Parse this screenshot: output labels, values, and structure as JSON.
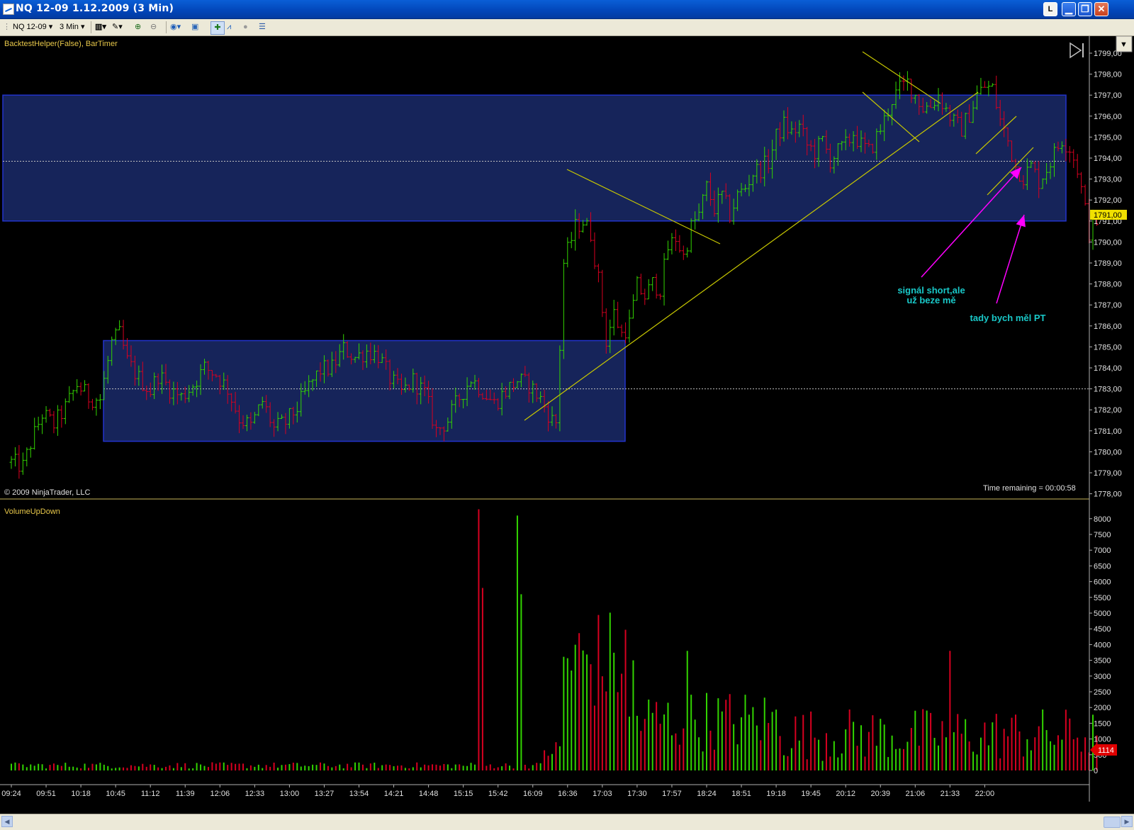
{
  "window": {
    "title": "NQ 12-09  1.12.2009 (3 Min)",
    "layout_button": "L"
  },
  "toolbar": {
    "instrument": "NQ 12-09",
    "interval": "3 Min"
  },
  "price_panel": {
    "indicator_label": "BacktestHelper(False), BarTimer",
    "copyright": "© 2009 NinjaTrader, LLC",
    "time_remaining": "Time remaining = 00:00:58",
    "current_price": "1791,00",
    "annotations": {
      "signal_line1": "signál short,ale",
      "signal_line2": "už beze mě",
      "pt_note": "tady bych měl PT"
    },
    "colors": {
      "up": "#32d400",
      "down": "#d80020",
      "zone": "#1a2a6a",
      "trendline": "#c8c800",
      "arrow": "#ff00ff",
      "annotation": "#19c8c8"
    }
  },
  "volume_panel": {
    "indicator_label": "VolumeUpDown",
    "current_volume": "1114"
  },
  "chart_data": [
    {
      "type": "candlestick",
      "title": "NQ 12-09  1.12.2009 (3 Min)",
      "ylim": [
        1777.5,
        1799.5
      ],
      "y_ticks": [
        "1778,00",
        "1779,00",
        "1780,00",
        "1781,00",
        "1782,00",
        "1783,00",
        "1784,00",
        "1785,00",
        "1786,00",
        "1787,00",
        "1788,00",
        "1789,00",
        "1790,00",
        "1791,00",
        "1792,00",
        "1793,00",
        "1794,00",
        "1795,00",
        "1796,00",
        "1797,00",
        "1798,00",
        "1799,00"
      ],
      "x_ticks": [
        "09:24",
        "09:51",
        "10:18",
        "10:45",
        "11:12",
        "11:39",
        "12:06",
        "12:33",
        "13:00",
        "13:27",
        "13:54",
        "14:21",
        "14:48",
        "15:15",
        "15:42",
        "16:09",
        "16:36",
        "17:03",
        "17:30",
        "17:57",
        "18:24",
        "18:51",
        "19:18",
        "19:45",
        "20:12",
        "20:39",
        "21:06",
        "21:33",
        "22:00"
      ],
      "zones": [
        {
          "from": 1791.0,
          "to": 1797.0,
          "midline": 1793.85
        },
        {
          "from": 1780.5,
          "to": 1785.3,
          "midline": 1783.0
        }
      ],
      "close_path": [
        [
          0,
          1779.5
        ],
        [
          3,
          1779.3
        ],
        [
          5,
          1780.4
        ],
        [
          8,
          1781.8
        ],
        [
          11,
          1781.3
        ],
        [
          14,
          1782.1
        ],
        [
          17,
          1783.2
        ],
        [
          20,
          1782.6
        ],
        [
          23,
          1782.5
        ],
        [
          26,
          1785.2
        ],
        [
          28,
          1785.6
        ],
        [
          30,
          1784.3
        ],
        [
          33,
          1783.5
        ],
        [
          36,
          1782.9
        ],
        [
          38,
          1783.7
        ],
        [
          41,
          1783.0
        ],
        [
          44,
          1782.6
        ],
        [
          47,
          1783.2
        ],
        [
          50,
          1784.0
        ],
        [
          53,
          1783.7
        ],
        [
          56,
          1783.0
        ],
        [
          59,
          1781.6
        ],
        [
          62,
          1781.2
        ],
        [
          65,
          1782.4
        ],
        [
          68,
          1781.1
        ],
        [
          71,
          1781.4
        ],
        [
          74,
          1782.1
        ],
        [
          77,
          1783.1
        ],
        [
          80,
          1783.9
        ],
        [
          83,
          1784.0
        ],
        [
          86,
          1784.9
        ],
        [
          89,
          1784.5
        ],
        [
          92,
          1784.8
        ],
        [
          95,
          1784.6
        ],
        [
          98,
          1783.5
        ],
        [
          101,
          1782.8
        ],
        [
          104,
          1783.4
        ],
        [
          107,
          1782.8
        ],
        [
          110,
          1781.0
        ],
        [
          113,
          1781.5
        ],
        [
          116,
          1782.6
        ],
        [
          119,
          1783.5
        ],
        [
          122,
          1782.9
        ],
        [
          125,
          1782.3
        ],
        [
          128,
          1782.9
        ],
        [
          131,
          1783.4
        ],
        [
          134,
          1783.2
        ],
        [
          137,
          1782.5
        ],
        [
          140,
          1781.5
        ],
        [
          141,
          1781.4
        ],
        [
          142,
          1785.0
        ],
        [
          143,
          1789.0
        ],
        [
          146,
          1790.7
        ],
        [
          148,
          1791.0
        ],
        [
          150,
          1790.4
        ],
        [
          152,
          1788.2
        ],
        [
          154,
          1785.3
        ],
        [
          156,
          1786.6
        ],
        [
          158,
          1785.6
        ],
        [
          160,
          1786.1
        ],
        [
          162,
          1787.9
        ],
        [
          164,
          1787.4
        ],
        [
          166,
          1788.0
        ],
        [
          168,
          1787.8
        ],
        [
          170,
          1789.7
        ],
        [
          172,
          1790.2
        ],
        [
          174,
          1789.3
        ],
        [
          176,
          1790.7
        ],
        [
          178,
          1791.3
        ],
        [
          180,
          1792.6
        ],
        [
          182,
          1791.6
        ],
        [
          184,
          1792.2
        ],
        [
          186,
          1791.3
        ],
        [
          188,
          1792.2
        ],
        [
          190,
          1792.6
        ],
        [
          192,
          1793.3
        ],
        [
          194,
          1793.5
        ],
        [
          196,
          1793.8
        ],
        [
          198,
          1795.0
        ],
        [
          200,
          1795.6
        ],
        [
          202,
          1795.2
        ],
        [
          204,
          1795.5
        ],
        [
          206,
          1794.6
        ],
        [
          208,
          1794.3
        ],
        [
          210,
          1794.8
        ],
        [
          212,
          1793.9
        ],
        [
          214,
          1794.3
        ],
        [
          216,
          1794.6
        ],
        [
          218,
          1795.2
        ],
        [
          220,
          1794.6
        ],
        [
          222,
          1794.3
        ],
        [
          224,
          1795.0
        ],
        [
          226,
          1795.8
        ],
        [
          228,
          1796.8
        ],
        [
          230,
          1797.3
        ],
        [
          232,
          1797.6
        ],
        [
          234,
          1797.0
        ],
        [
          236,
          1796.4
        ],
        [
          238,
          1796.5
        ],
        [
          240,
          1797.0
        ],
        [
          242,
          1796.3
        ],
        [
          244,
          1795.7
        ],
        [
          246,
          1795.4
        ],
        [
          248,
          1796.1
        ],
        [
          250,
          1797.0
        ],
        [
          252,
          1797.4
        ],
        [
          254,
          1797.3
        ],
        [
          256,
          1795.8
        ],
        [
          258,
          1794.8
        ],
        [
          260,
          1793.6
        ],
        [
          262,
          1793.1
        ],
        [
          264,
          1793.6
        ],
        [
          266,
          1792.9
        ],
        [
          268,
          1793.5
        ],
        [
          270,
          1794.2
        ],
        [
          272,
          1794.9
        ],
        [
          274,
          1794.5
        ],
        [
          276,
          1793.5
        ],
        [
          278,
          1791.5
        ],
        [
          279,
          1790.5
        ],
        [
          281,
          1791.0
        ]
      ]
    },
    {
      "type": "bar",
      "title": "VolumeUpDown",
      "ylim": [
        0,
        8200
      ],
      "y_ticks": [
        "0",
        "500",
        "1000",
        "1500",
        "2000",
        "2500",
        "3000",
        "3500",
        "4000",
        "4500",
        "5000",
        "5500",
        "6000",
        "6500",
        "7000",
        "7500",
        "8000"
      ],
      "peaks": [
        {
          "time": "15:27",
          "volume": 8300
        },
        {
          "time": "15:57",
          "volume": 8100
        },
        {
          "time": "15:30",
          "volume": 5800
        },
        {
          "time": "16:00",
          "volume": 5600
        },
        {
          "time": "17:27",
          "volume": 3500
        },
        {
          "time": "18:09",
          "volume": 3800
        },
        {
          "time": "21:33",
          "volume": 3800
        }
      ],
      "last_value": 1114
    }
  ]
}
